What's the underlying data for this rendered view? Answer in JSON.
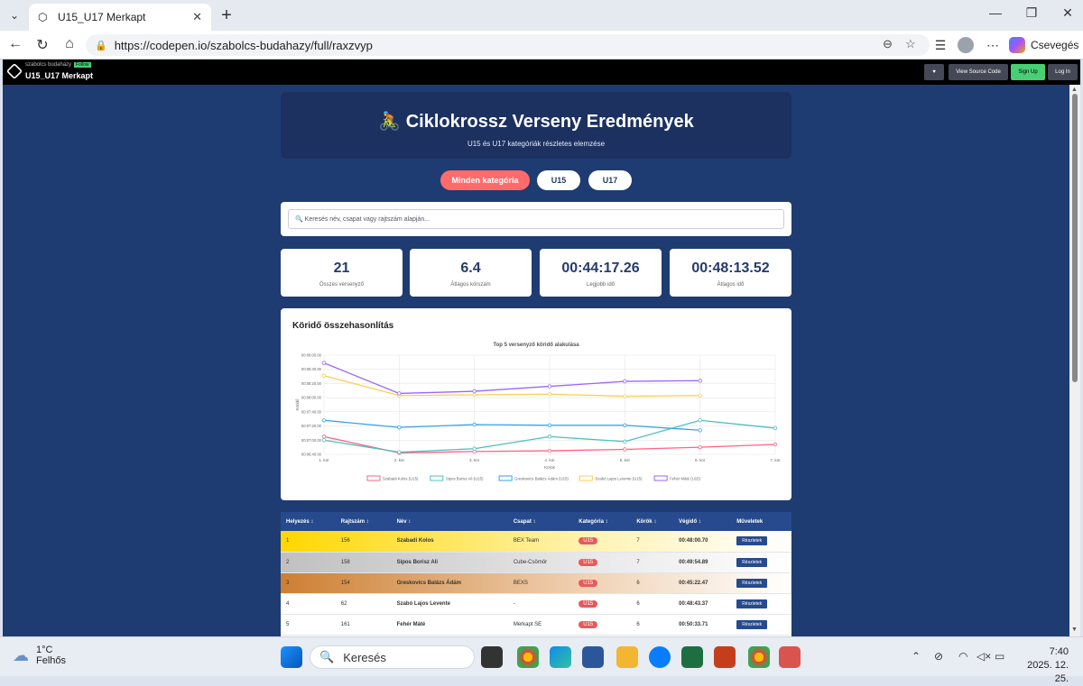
{
  "browser": {
    "tab_title": "U15_U17 Merkapt",
    "url": "https://codepen.io/szabolcs-budahazy/full/raxzvyp",
    "copilot_label": "Csevegés"
  },
  "codepen": {
    "user": "szabolcs budahazy",
    "badge": "Follow",
    "title": "U15_U17 Merkapt",
    "heart_icon": "♥",
    "view_source": "View Source Code",
    "sign_up": "Sign Up",
    "log_in": "Log In"
  },
  "hero": {
    "icon": "🚴",
    "title": "Ciklokrossz Verseny Eredmények",
    "subtitle": "U15 és U17 kategóriák részletes elemzése"
  },
  "filters": [
    "Minden kategória",
    "U15",
    "U17"
  ],
  "search": {
    "placeholder": "🔍 Keresés név, csapat vagy rajtszám alapján..."
  },
  "stats": [
    {
      "value": "21",
      "label": "Összes versenyző"
    },
    {
      "value": "6.4",
      "label": "Átlagos körszám"
    },
    {
      "value": "00:44:17.26",
      "label": "Legjobb idő"
    },
    {
      "value": "00:48:13.52",
      "label": "Átlagos idő"
    }
  ],
  "chart_section_title": "Köridő összehasonlítás",
  "chart_data": {
    "type": "line",
    "title": "Top 5 versenyző köridő alakulása",
    "xlabel": "Körök",
    "ylabel": "Köridő",
    "categories": [
      "1. kör",
      "2. kör",
      "3. kör",
      "4. kör",
      "5. kör",
      "6. kör",
      "7. kör"
    ],
    "y_ticks": [
      "00:09:00.00",
      "00:08:40.00",
      "00:08:20.00",
      "00:08:00.00",
      "00:07:40.00",
      "00:07:20.00",
      "00:07:00.00",
      "00:06:40.00"
    ],
    "ylim_seconds": [
      400,
      540
    ],
    "series": [
      {
        "name": "Szabadi Kolos (U15)",
        "color": "#ff6384",
        "values": [
          425,
          402,
          404,
          405,
          407,
          410,
          414
        ]
      },
      {
        "name": "Sipos Borisz Ali (U15)",
        "color": "#4bc0c0",
        "values": [
          420,
          403,
          408,
          425,
          418,
          448,
          437
        ]
      },
      {
        "name": "Greskovics Balázs Ádám (U15)",
        "color": "#36a2eb",
        "values": [
          448,
          438,
          442,
          441,
          441,
          434,
          null
        ]
      },
      {
        "name": "Szabó Lajos Levente (U15)",
        "color": "#ffcd56",
        "values": [
          511,
          483,
          484,
          485,
          482,
          483,
          null
        ]
      },
      {
        "name": "Fehér Máté (U15)",
        "color": "#9966ff",
        "values": [
          529,
          486,
          489,
          496,
          503,
          504,
          null
        ]
      }
    ]
  },
  "table": {
    "headers": [
      "Helyezés ↕",
      "Rajtszám ↕",
      "Név ↕",
      "Csapat ↕",
      "Kategória ↕",
      "Körök ↕",
      "Végidő ↕",
      "Műveletek"
    ],
    "rows": [
      [
        "1",
        "156",
        "Szabadi Kolos",
        "BEX Team",
        "U15",
        "7",
        "00:48:00.70",
        "Részletek"
      ],
      [
        "2",
        "158",
        "Sipos Borisz Ali",
        "Cube-Csömör",
        "U15",
        "7",
        "00:49:54.89",
        "Részletek"
      ],
      [
        "3",
        "154",
        "Greskovics Balázs Ádám",
        "BEXS",
        "U15",
        "6",
        "00:45:22.47",
        "Részletek"
      ],
      [
        "4",
        "62",
        "Szabó Lajos Levente",
        "-",
        "U15",
        "6",
        "00:48:43.37",
        "Részletek"
      ],
      [
        "5",
        "161",
        "Fehér Máté",
        "Merkapt SE",
        "U15",
        "6",
        "00:50:33.71",
        "Részletek"
      ]
    ]
  },
  "taskbar": {
    "temp": "1°C",
    "weather": "Felhős",
    "search": "Keresés",
    "time": "7:40",
    "date": "2025. 12. 25."
  }
}
